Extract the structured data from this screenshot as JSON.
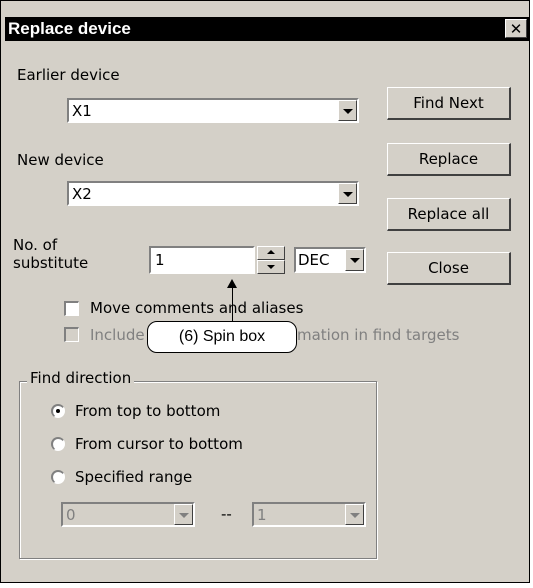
{
  "dialog": {
    "title": "Replace device",
    "close_glyph": "✕"
  },
  "fields": {
    "earlier_label": "Earlier device",
    "earlier_value": "X1",
    "new_label": "New device",
    "new_value": "X2",
    "substitute_label_line1": "No. of",
    "substitute_label_line2": "substitute",
    "substitute_value": "1",
    "radix_value": "DEC"
  },
  "buttons": {
    "find_next": "Find Next",
    "replace": "Replace",
    "replace_all": "Replace all",
    "close": "Close"
  },
  "options": {
    "move_comments_label": "Move comments and aliases",
    "include_label_start": "Include",
    "include_label_end": "mation in find targets"
  },
  "find_direction": {
    "label": "Find direction",
    "radios": [
      {
        "label": "From top to bottom",
        "checked": true
      },
      {
        "label": "From cursor to bottom",
        "checked": false
      },
      {
        "label": "Specified range",
        "checked": false
      }
    ],
    "range_from": "0",
    "range_separator": "--",
    "range_to": "1"
  },
  "annotation": {
    "callout_text": "(6) Spin box"
  }
}
